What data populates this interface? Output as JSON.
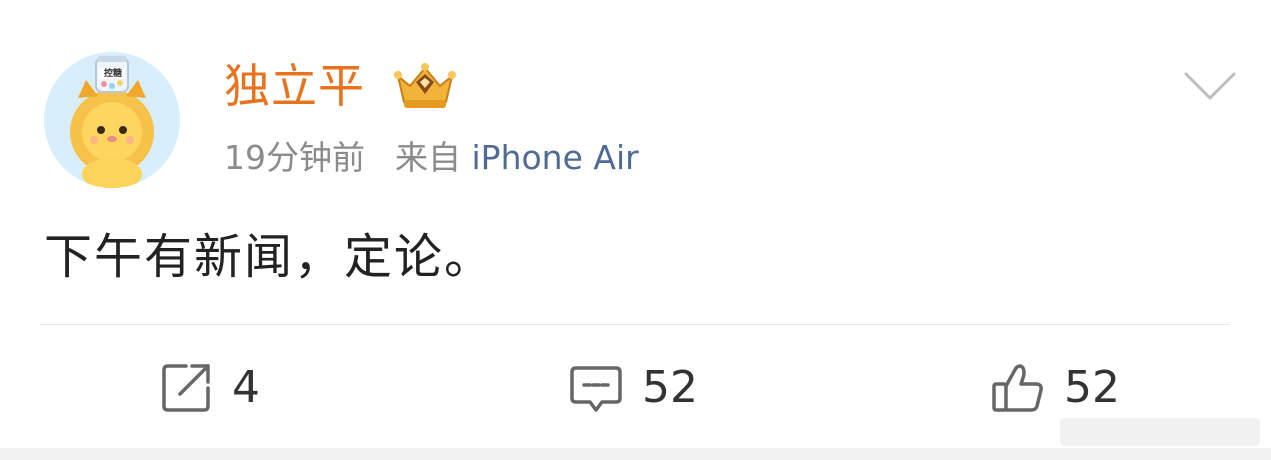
{
  "post": {
    "author": "独立平",
    "time": "19分钟前",
    "source_prefix": "来自",
    "source_device": "iPhone Air",
    "text": "下午有新闻，定论。",
    "avatar_tag": "控糖"
  },
  "actions": {
    "repost_count": "4",
    "comment_count": "52",
    "like_count": "52"
  },
  "colors": {
    "username": "#e8731e",
    "device": "#4f6b95",
    "meta": "#8b8b8b",
    "icon": "#666666"
  },
  "icons": [
    "vip-crown-icon",
    "chevron-down-icon",
    "repost-icon",
    "comment-icon",
    "like-icon"
  ]
}
